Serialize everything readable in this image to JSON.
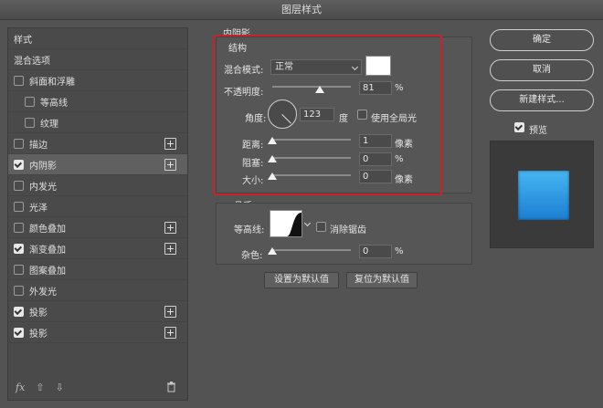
{
  "window": {
    "title": "图层样式"
  },
  "left_panel": {
    "header": "样式",
    "blend_options": "混合选项",
    "items": [
      {
        "label": "斜面和浮雕",
        "checked": false,
        "indent": 0,
        "plus": false
      },
      {
        "label": "等高线",
        "checked": false,
        "indent": 1,
        "plus": false
      },
      {
        "label": "纹理",
        "checked": false,
        "indent": 1,
        "plus": false
      },
      {
        "label": "描边",
        "checked": false,
        "indent": 0,
        "plus": true
      },
      {
        "label": "内阴影",
        "checked": true,
        "indent": 0,
        "plus": true,
        "selected": true
      },
      {
        "label": "内发光",
        "checked": false,
        "indent": 0,
        "plus": false
      },
      {
        "label": "光泽",
        "checked": false,
        "indent": 0,
        "plus": false
      },
      {
        "label": "颜色叠加",
        "checked": false,
        "indent": 0,
        "plus": true
      },
      {
        "label": "渐变叠加",
        "checked": true,
        "indent": 0,
        "plus": true
      },
      {
        "label": "图案叠加",
        "checked": false,
        "indent": 0,
        "plus": false
      },
      {
        "label": "外发光",
        "checked": false,
        "indent": 0,
        "plus": false
      },
      {
        "label": "投影",
        "checked": true,
        "indent": 0,
        "plus": true
      },
      {
        "label": "投影",
        "checked": true,
        "indent": 0,
        "plus": true
      }
    ],
    "footer": {
      "fx": "fx",
      "up": "⇧",
      "down": "⇩",
      "trash": "trash-icon"
    }
  },
  "center_panel": {
    "section_title": "内阴影",
    "structure": {
      "title": "结构",
      "blend_mode_label": "混合模式:",
      "blend_mode_value": "正常",
      "blend_color": "#ffffff",
      "opacity_label": "不透明度:",
      "opacity_value": "81",
      "opacity_unit": "%",
      "angle_label": "角度:",
      "angle_value": "123",
      "angle_unit": "度",
      "global_light_label": "使用全局光",
      "global_light_checked": false,
      "distance_label": "距离:",
      "distance_value": "1",
      "distance_unit": "像素",
      "choke_label": "阻塞:",
      "choke_value": "0",
      "choke_unit": "%",
      "size_label": "大小:",
      "size_value": "0",
      "size_unit": "像素"
    },
    "quality": {
      "title": "品质",
      "contour_label": "等高线:",
      "antialias_label": "消除锯齿",
      "antialias_checked": false,
      "noise_label": "杂色:",
      "noise_value": "0",
      "noise_unit": "%"
    },
    "set_default": "设置为默认值",
    "reset_default": "复位为默认值"
  },
  "right_panel": {
    "ok": "确定",
    "cancel": "取消",
    "new_style": "新建样式...",
    "preview_label": "预览",
    "preview_checked": true,
    "highlight_color": "#c8232c"
  }
}
